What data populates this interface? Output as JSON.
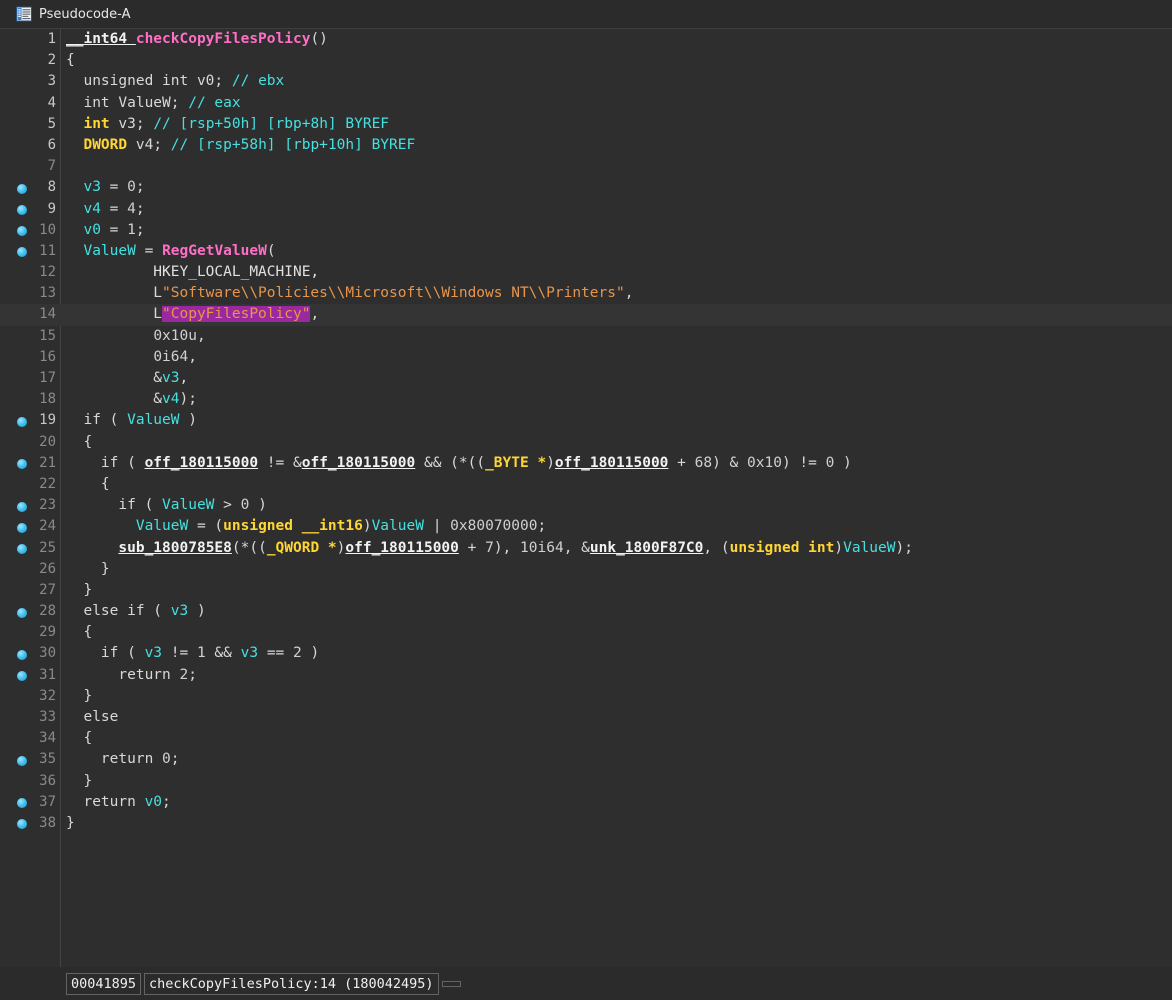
{
  "window": {
    "tab_title": "Pseudocode-A",
    "tab_icon": "pseudocode-document-icon"
  },
  "theme": {
    "background": "#2e2e2e",
    "chrome": "#2b2b2b",
    "gutter_separator": "#444444",
    "current_line": "#343434",
    "type_keyword": "#ffd633",
    "variable": "#45e0e0",
    "function_call": "#ff6ec7",
    "global_symbol": "#f2f2f2",
    "string_literal": "#e8954a",
    "comment": "#45e0e0",
    "highlight_background": "#9a29a0",
    "breakpoint_marker": "#45c3f0",
    "line_number": "#8a8a8a"
  },
  "editor": {
    "function_signature": "__int64 checkCopyFilesPolicy()",
    "lines": [
      {
        "n": 1,
        "bp": false,
        "bright": true,
        "cur": false,
        "tokens": [
          {
            "t": "__int64 ",
            "c": "glob"
          },
          {
            "t": "checkCopyFilesPolicy",
            "c": "fn"
          },
          {
            "t": "()",
            "c": "punc"
          }
        ]
      },
      {
        "n": 2,
        "bp": false,
        "bright": true,
        "cur": false,
        "tokens": [
          {
            "t": "{",
            "c": "punc"
          }
        ]
      },
      {
        "n": 3,
        "bp": false,
        "bright": true,
        "cur": false,
        "tokens": [
          {
            "t": "  unsigned int v0; ",
            "c": "kw"
          },
          {
            "t": "// ebx",
            "c": "cmt"
          }
        ]
      },
      {
        "n": 4,
        "bp": false,
        "bright": true,
        "cur": false,
        "tokens": [
          {
            "t": "  int ValueW; ",
            "c": "kw"
          },
          {
            "t": "// eax",
            "c": "cmt"
          }
        ]
      },
      {
        "n": 5,
        "bp": false,
        "bright": true,
        "cur": false,
        "tokens": [
          {
            "t": "  ",
            "c": "kw"
          },
          {
            "t": "int",
            "c": "ty"
          },
          {
            "t": " v3; ",
            "c": "kw"
          },
          {
            "t": "// [rsp+50h] [rbp+8h] BYREF",
            "c": "cmt"
          }
        ]
      },
      {
        "n": 6,
        "bp": false,
        "bright": true,
        "cur": false,
        "tokens": [
          {
            "t": "  ",
            "c": "kw"
          },
          {
            "t": "DWORD",
            "c": "ty"
          },
          {
            "t": " v4; ",
            "c": "kw"
          },
          {
            "t": "// [rsp+58h] [rbp+10h] BYREF",
            "c": "cmt"
          }
        ]
      },
      {
        "n": 7,
        "bp": false,
        "bright": false,
        "cur": false,
        "tokens": []
      },
      {
        "n": 8,
        "bp": true,
        "bright": true,
        "cur": false,
        "tokens": [
          {
            "t": "  ",
            "c": "punc"
          },
          {
            "t": "v3",
            "c": "var"
          },
          {
            "t": " = ",
            "c": "punc"
          },
          {
            "t": "0",
            "c": "num"
          },
          {
            "t": ";",
            "c": "punc"
          }
        ]
      },
      {
        "n": 9,
        "bp": true,
        "bright": true,
        "cur": false,
        "tokens": [
          {
            "t": "  ",
            "c": "punc"
          },
          {
            "t": "v4",
            "c": "var"
          },
          {
            "t": " = ",
            "c": "punc"
          },
          {
            "t": "4",
            "c": "num"
          },
          {
            "t": ";",
            "c": "punc"
          }
        ]
      },
      {
        "n": 10,
        "bp": true,
        "bright": false,
        "cur": false,
        "tokens": [
          {
            "t": "  ",
            "c": "punc"
          },
          {
            "t": "v0",
            "c": "var"
          },
          {
            "t": " = ",
            "c": "punc"
          },
          {
            "t": "1",
            "c": "num"
          },
          {
            "t": ";",
            "c": "punc"
          }
        ]
      },
      {
        "n": 11,
        "bp": true,
        "bright": false,
        "cur": false,
        "tokens": [
          {
            "t": "  ",
            "c": "punc"
          },
          {
            "t": "ValueW",
            "c": "var"
          },
          {
            "t": " = ",
            "c": "punc"
          },
          {
            "t": "RegGetValueW",
            "c": "fn"
          },
          {
            "t": "(",
            "c": "punc"
          }
        ]
      },
      {
        "n": 12,
        "bp": false,
        "bright": false,
        "cur": false,
        "tokens": [
          {
            "t": "          HKEY_LOCAL_MACHINE,",
            "c": "macro"
          }
        ]
      },
      {
        "n": 13,
        "bp": false,
        "bright": false,
        "cur": false,
        "tokens": [
          {
            "t": "          L",
            "c": "strq"
          },
          {
            "t": "\"Software\\\\Policies\\\\Microsoft\\\\Windows NT\\\\Printers\"",
            "c": "str"
          },
          {
            "t": ",",
            "c": "punc"
          }
        ]
      },
      {
        "n": 14,
        "bp": false,
        "bright": false,
        "cur": true,
        "tokens": [
          {
            "t": "          L",
            "c": "strq"
          },
          {
            "t": "\"CopyFilesPolicy\"",
            "c": "hl"
          },
          {
            "t": ",",
            "c": "punc"
          }
        ]
      },
      {
        "n": 15,
        "bp": false,
        "bright": false,
        "cur": false,
        "tokens": [
          {
            "t": "          ",
            "c": "punc"
          },
          {
            "t": "0x10u",
            "c": "num"
          },
          {
            "t": ",",
            "c": "punc"
          }
        ]
      },
      {
        "n": 16,
        "bp": false,
        "bright": false,
        "cur": false,
        "tokens": [
          {
            "t": "          ",
            "c": "punc"
          },
          {
            "t": "0i64",
            "c": "num"
          },
          {
            "t": ",",
            "c": "punc"
          }
        ]
      },
      {
        "n": 17,
        "bp": false,
        "bright": false,
        "cur": false,
        "tokens": [
          {
            "t": "          &",
            "c": "punc"
          },
          {
            "t": "v3",
            "c": "var"
          },
          {
            "t": ",",
            "c": "punc"
          }
        ]
      },
      {
        "n": 18,
        "bp": false,
        "bright": false,
        "cur": false,
        "tokens": [
          {
            "t": "          &",
            "c": "punc"
          },
          {
            "t": "v4",
            "c": "var"
          },
          {
            "t": ");",
            "c": "punc"
          }
        ]
      },
      {
        "n": 19,
        "bp": true,
        "bright": true,
        "cur": false,
        "tokens": [
          {
            "t": "  if ( ",
            "c": "kw"
          },
          {
            "t": "ValueW",
            "c": "var"
          },
          {
            "t": " )",
            "c": "punc"
          }
        ]
      },
      {
        "n": 20,
        "bp": false,
        "bright": false,
        "cur": false,
        "tokens": [
          {
            "t": "  {",
            "c": "punc"
          }
        ]
      },
      {
        "n": 21,
        "bp": true,
        "bright": false,
        "cur": false,
        "tokens": [
          {
            "t": "    if ( ",
            "c": "kw"
          },
          {
            "t": "off_180115000",
            "c": "glob"
          },
          {
            "t": " != &",
            "c": "punc"
          },
          {
            "t": "off_180115000",
            "c": "glob"
          },
          {
            "t": " && (*((",
            "c": "punc"
          },
          {
            "t": "_BYTE *",
            "c": "ty"
          },
          {
            "t": ")",
            "c": "punc"
          },
          {
            "t": "off_180115000",
            "c": "glob"
          },
          {
            "t": " + ",
            "c": "punc"
          },
          {
            "t": "68",
            "c": "num"
          },
          {
            "t": ") & ",
            "c": "punc"
          },
          {
            "t": "0x10",
            "c": "num"
          },
          {
            "t": ") != ",
            "c": "punc"
          },
          {
            "t": "0",
            "c": "num"
          },
          {
            "t": " )",
            "c": "punc"
          }
        ]
      },
      {
        "n": 22,
        "bp": false,
        "bright": false,
        "cur": false,
        "tokens": [
          {
            "t": "    {",
            "c": "punc"
          }
        ]
      },
      {
        "n": 23,
        "bp": true,
        "bright": false,
        "cur": false,
        "tokens": [
          {
            "t": "      if ( ",
            "c": "kw"
          },
          {
            "t": "ValueW",
            "c": "var"
          },
          {
            "t": " > ",
            "c": "punc"
          },
          {
            "t": "0",
            "c": "num"
          },
          {
            "t": " )",
            "c": "punc"
          }
        ]
      },
      {
        "n": 24,
        "bp": true,
        "bright": false,
        "cur": false,
        "tokens": [
          {
            "t": "        ",
            "c": "punc"
          },
          {
            "t": "ValueW",
            "c": "var"
          },
          {
            "t": " = (",
            "c": "punc"
          },
          {
            "t": "unsigned __int16",
            "c": "ty"
          },
          {
            "t": ")",
            "c": "punc"
          },
          {
            "t": "ValueW",
            "c": "var"
          },
          {
            "t": " | ",
            "c": "punc"
          },
          {
            "t": "0x80070000",
            "c": "num"
          },
          {
            "t": ";",
            "c": "punc"
          }
        ]
      },
      {
        "n": 25,
        "bp": true,
        "bright": false,
        "cur": false,
        "tokens": [
          {
            "t": "      ",
            "c": "punc"
          },
          {
            "t": "sub_1800785E8",
            "c": "glob"
          },
          {
            "t": "(*((",
            "c": "punc"
          },
          {
            "t": "_QWORD *",
            "c": "ty"
          },
          {
            "t": ")",
            "c": "punc"
          },
          {
            "t": "off_180115000",
            "c": "glob"
          },
          {
            "t": " + ",
            "c": "punc"
          },
          {
            "t": "7",
            "c": "num"
          },
          {
            "t": "), ",
            "c": "punc"
          },
          {
            "t": "10i64",
            "c": "num"
          },
          {
            "t": ", &",
            "c": "punc"
          },
          {
            "t": "unk_1800F87C0",
            "c": "glob"
          },
          {
            "t": ", (",
            "c": "punc"
          },
          {
            "t": "unsigned int",
            "c": "ty"
          },
          {
            "t": ")",
            "c": "punc"
          },
          {
            "t": "ValueW",
            "c": "var"
          },
          {
            "t": ");",
            "c": "punc"
          }
        ]
      },
      {
        "n": 26,
        "bp": false,
        "bright": false,
        "cur": false,
        "tokens": [
          {
            "t": "    }",
            "c": "punc"
          }
        ]
      },
      {
        "n": 27,
        "bp": false,
        "bright": false,
        "cur": false,
        "tokens": [
          {
            "t": "  }",
            "c": "punc"
          }
        ]
      },
      {
        "n": 28,
        "bp": true,
        "bright": false,
        "cur": false,
        "tokens": [
          {
            "t": "  else if ( ",
            "c": "kw"
          },
          {
            "t": "v3",
            "c": "var"
          },
          {
            "t": " )",
            "c": "punc"
          }
        ]
      },
      {
        "n": 29,
        "bp": false,
        "bright": false,
        "cur": false,
        "tokens": [
          {
            "t": "  {",
            "c": "punc"
          }
        ]
      },
      {
        "n": 30,
        "bp": true,
        "bright": false,
        "cur": false,
        "tokens": [
          {
            "t": "    if ( ",
            "c": "kw"
          },
          {
            "t": "v3",
            "c": "var"
          },
          {
            "t": " != ",
            "c": "punc"
          },
          {
            "t": "1",
            "c": "num"
          },
          {
            "t": " && ",
            "c": "punc"
          },
          {
            "t": "v3",
            "c": "var"
          },
          {
            "t": " == ",
            "c": "punc"
          },
          {
            "t": "2",
            "c": "num"
          },
          {
            "t": " )",
            "c": "punc"
          }
        ]
      },
      {
        "n": 31,
        "bp": true,
        "bright": false,
        "cur": false,
        "tokens": [
          {
            "t": "      return ",
            "c": "kw"
          },
          {
            "t": "2",
            "c": "num"
          },
          {
            "t": ";",
            "c": "punc"
          }
        ]
      },
      {
        "n": 32,
        "bp": false,
        "bright": false,
        "cur": false,
        "tokens": [
          {
            "t": "  }",
            "c": "punc"
          }
        ]
      },
      {
        "n": 33,
        "bp": false,
        "bright": false,
        "cur": false,
        "tokens": [
          {
            "t": "  else",
            "c": "kw"
          }
        ]
      },
      {
        "n": 34,
        "bp": false,
        "bright": false,
        "cur": false,
        "tokens": [
          {
            "t": "  {",
            "c": "punc"
          }
        ]
      },
      {
        "n": 35,
        "bp": true,
        "bright": false,
        "cur": false,
        "tokens": [
          {
            "t": "    return ",
            "c": "kw"
          },
          {
            "t": "0",
            "c": "num"
          },
          {
            "t": ";",
            "c": "punc"
          }
        ]
      },
      {
        "n": 36,
        "bp": false,
        "bright": false,
        "cur": false,
        "tokens": [
          {
            "t": "  }",
            "c": "punc"
          }
        ]
      },
      {
        "n": 37,
        "bp": true,
        "bright": false,
        "cur": false,
        "tokens": [
          {
            "t": "  return ",
            "c": "kw"
          },
          {
            "t": "v0",
            "c": "var"
          },
          {
            "t": ";",
            "c": "punc"
          }
        ]
      },
      {
        "n": 38,
        "bp": true,
        "bright": false,
        "cur": false,
        "tokens": [
          {
            "t": "}",
            "c": "punc"
          }
        ]
      }
    ]
  },
  "statusbar": {
    "file_offset": "00041895",
    "location": "checkCopyFilesPolicy:14 (180042495)",
    "extra": ""
  }
}
